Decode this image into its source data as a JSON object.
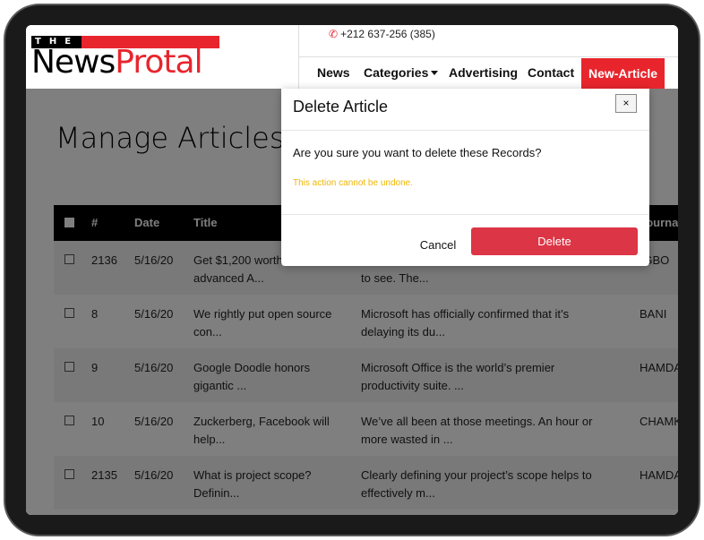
{
  "header": {
    "logo_the": "THE",
    "logo_news": "News",
    "logo_protal": "Protal",
    "phone": "+212 637-256 (385)",
    "nav": [
      {
        "label": "News"
      },
      {
        "label": "Categories"
      },
      {
        "label": "Advertising"
      },
      {
        "label": "Contact"
      }
    ],
    "cta": "New-Article"
  },
  "page": {
    "title": "Manage Articles"
  },
  "table": {
    "columns": [
      "#",
      "Date",
      "Title",
      "Journa"
    ],
    "rows": [
      {
        "id": "2136",
        "date": "5/16/20",
        "title1": "Get $1,200 worth",
        "title2": "advanced A...",
        "desc1": "",
        "desc2": "to see. The...",
        "journalist": "-GBO"
      },
      {
        "id": "8",
        "date": "5/16/20",
        "title1": "We rightly put open source",
        "title2": "con...",
        "desc1": "Microsoft has officially confirmed that it’s",
        "desc2": "delaying its du...",
        "journalist": "BANI"
      },
      {
        "id": "9",
        "date": "5/16/20",
        "title1": "Google Doodle honors",
        "title2": "gigantic ...",
        "desc1": "Microsoft Office is the world’s premier",
        "desc2": "productivity suite. ...",
        "journalist": "HAMDA"
      },
      {
        "id": "10",
        "date": "5/16/20",
        "title1": "Zuckerberg, Facebook will",
        "title2": "help...",
        "desc1": "We’ve all been at those meetings. An hour or",
        "desc2": "more wasted in ...",
        "journalist": "CHAMK"
      },
      {
        "id": "2135",
        "date": "5/16/20",
        "title1": "What is project scope?",
        "title2": "Definin...",
        "desc1": "Clearly defining your project’s scope helps to",
        "desc2": "effectively m...",
        "journalist": "HAMDA"
      }
    ]
  },
  "modal": {
    "title": "Delete Article",
    "close": "×",
    "question": "Are you sure you want to delete these Records?",
    "warning": "This action cannot be undone.",
    "cancel": "Cancel",
    "delete": "Delete"
  }
}
